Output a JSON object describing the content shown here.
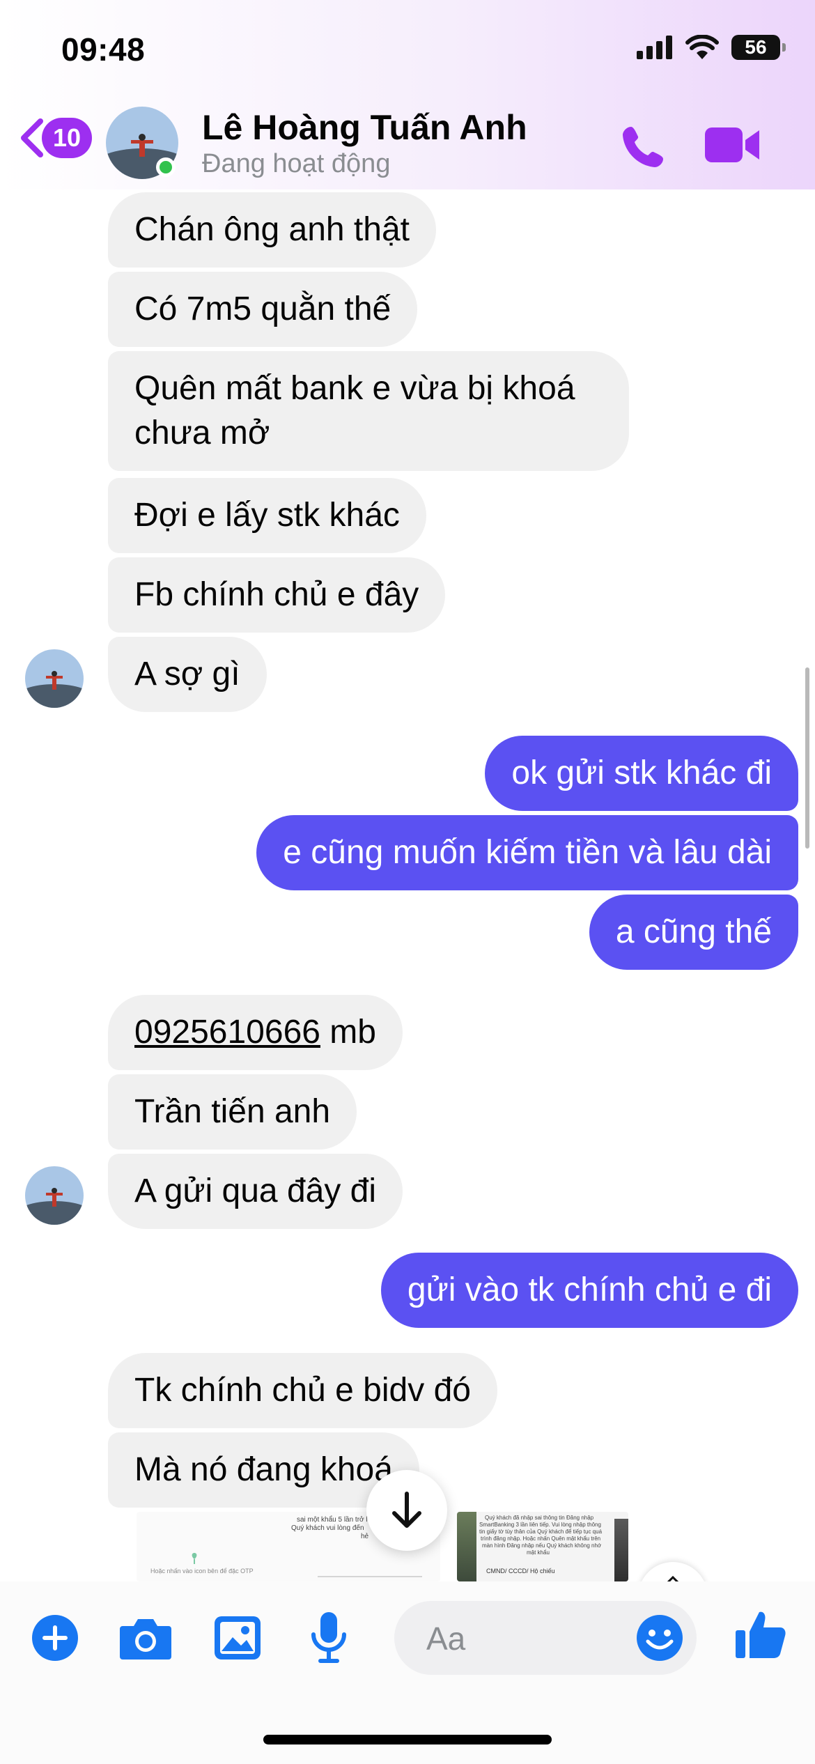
{
  "status_bar": {
    "time": "09:48",
    "battery": "56"
  },
  "header": {
    "back_badge": "10",
    "contact_name": "Lê Hoàng Tuấn Anh",
    "contact_status": "Đang hoạt động"
  },
  "messages": [
    {
      "dir": "in",
      "text": "Chán ông anh thật"
    },
    {
      "dir": "in",
      "text": "Có 7m5 quằn thế"
    },
    {
      "dir": "in",
      "text": "Quên mất bank e vừa bị khoá chưa mở"
    },
    {
      "dir": "in",
      "text": "Đợi e lấy stk khác"
    },
    {
      "dir": "in",
      "text": "Fb chính chủ e đây"
    },
    {
      "dir": "in",
      "text": "A sợ gì"
    },
    {
      "dir": "out",
      "text": "ok gửi stk khác đi"
    },
    {
      "dir": "out",
      "text": "e cũng muốn kiếm tiền và lâu dài"
    },
    {
      "dir": "out",
      "text": "a cũng thế"
    },
    {
      "dir": "in",
      "phone": "0925610666",
      "suffix": " mb"
    },
    {
      "dir": "in",
      "text": "Trần tiến anh"
    },
    {
      "dir": "in",
      "text": "A gửi qua đây đi"
    },
    {
      "dir": "out",
      "text": "gửi vào tk chính chủ e đi"
    },
    {
      "dir": "in",
      "text": "Tk chính chủ e bidv đó"
    },
    {
      "dir": "in",
      "text": "Mà nó đang khoá"
    }
  ],
  "attachments": {
    "left_lines": [
      "sai một khẩu 5 lần trở l",
      "Quý khách vui lòng đến",
      "hẻ"
    ],
    "left_caption": "Hoặc nhấn vào icon bên để đặc OTP",
    "right_lines": [
      "Quý khách đã nhập sai thông tin Đăng nhập",
      "SmartBanking 3 lần liên tiếp. Vui lòng nhập thông",
      "tin giấy tờ tùy thân của Quý khách để tiếp tục quá",
      "trình đăng nhập. Hoặc nhấn Quên mật khẩu trên",
      "màn hình Đăng nhập nếu Quý khách không nhớ",
      "mật khẩu"
    ],
    "right_field": "CMND/ CCCD/ Hộ chiếu"
  },
  "composer": {
    "placeholder": "Aa"
  },
  "colors": {
    "sent_bubble": "#5b51f2",
    "received_bubble": "#f0f0f0",
    "accent": "#9d2ff0",
    "tool_blue": "#1877f2"
  },
  "icons": [
    "cellular-icon",
    "wifi-icon",
    "battery-icon",
    "back-chevron-icon",
    "phone-icon",
    "video-icon",
    "arrow-down-icon",
    "plus-icon",
    "camera-icon",
    "gallery-icon",
    "microphone-icon",
    "emoji-icon",
    "thumbs-up-icon"
  ]
}
